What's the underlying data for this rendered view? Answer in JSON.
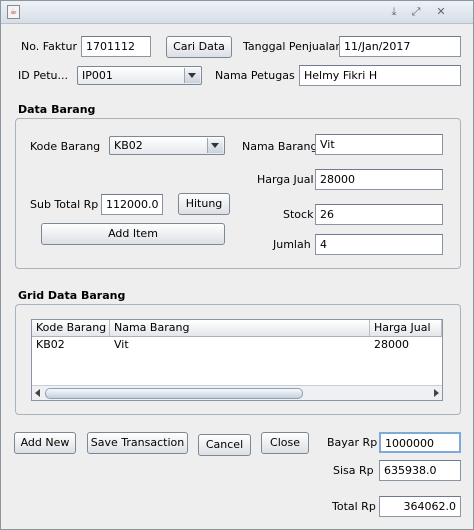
{
  "window": {
    "title": "",
    "icon": "java-icon",
    "controls": [
      "minimize-icon",
      "maximize-icon",
      "close-icon"
    ]
  },
  "header": {
    "no_faktur_label": "No. Faktur",
    "no_faktur_value": "1701112",
    "cari_data_label": "Cari Data",
    "tanggal_label": "Tanggal Penjualan",
    "tanggal_value": "11/Jan/2017",
    "id_petugas_label": "ID Petu...",
    "id_petugas_value": "IP001",
    "nama_petugas_label": "Nama Petugas",
    "nama_petugas_value": "Helmy Fikri H"
  },
  "data_barang": {
    "title": "Data Barang",
    "kode_barang_label": "Kode Barang",
    "kode_barang_value": "KB02",
    "nama_barang_label": "Nama Barang",
    "nama_barang_value": "Vit",
    "harga_jual_label": "Harga Jual",
    "harga_jual_value": "28000",
    "sub_total_label": "Sub Total  Rp",
    "sub_total_value": "112000.0",
    "hitung_label": "Hitung",
    "stock_label": "Stock",
    "stock_value": "26",
    "add_item_label": "Add Item",
    "jumlah_label": "Jumlah",
    "jumlah_value": "4"
  },
  "grid": {
    "title": "Grid Data Barang",
    "columns": [
      "Kode Barang",
      "Nama Barang",
      "Harga Jual"
    ],
    "rows": [
      [
        "KB02",
        "Vit",
        "28000"
      ]
    ]
  },
  "footer": {
    "add_new_label": "Add New",
    "save_label": "Save Transaction",
    "cancel_label": "Cancel",
    "close_label": "Close",
    "bayar_label": "Bayar  Rp",
    "bayar_value": "1000000",
    "sisa_label": "Sisa  Rp",
    "sisa_value": "635938.0",
    "total_label": "Total  Rp",
    "total_value": "364062.0"
  }
}
